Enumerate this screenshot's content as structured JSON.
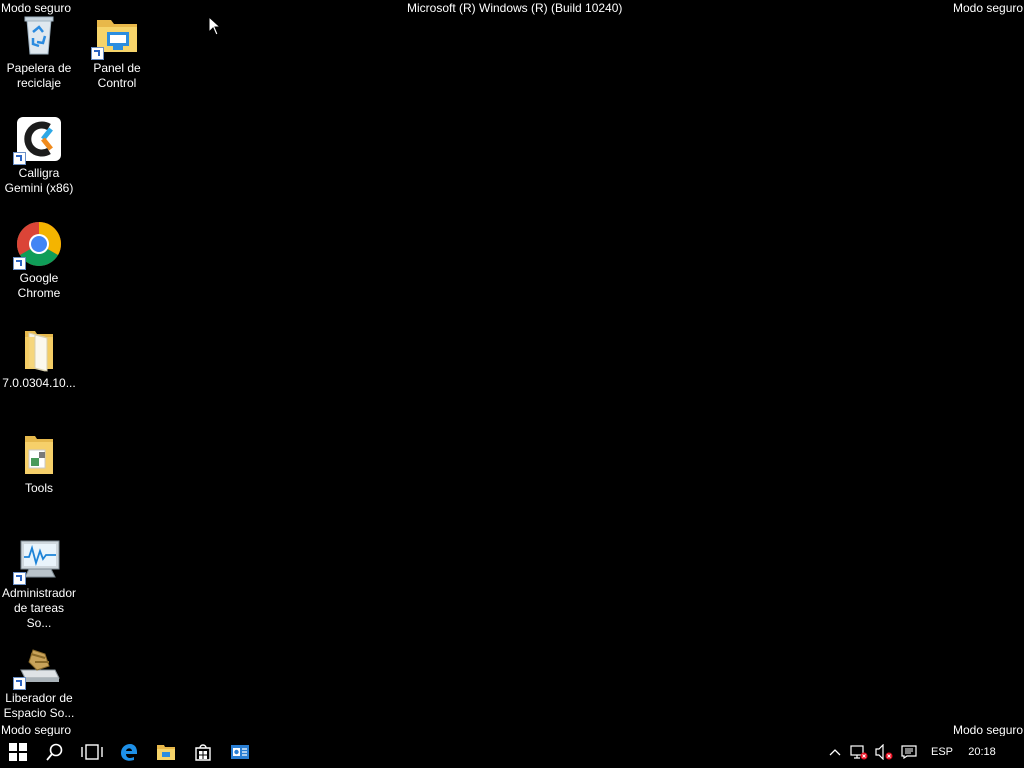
{
  "overlay": {
    "safe_mode": "Modo seguro",
    "build": "Microsoft (R) Windows (R) (Build 10240)"
  },
  "desktop_icons": [
    {
      "label": "Papelera de reciclaje",
      "icon": "recycle-bin-icon"
    },
    {
      "label": "Panel de Control",
      "icon": "control-panel-icon"
    },
    {
      "label": "Calligra Gemini (x86)",
      "icon": "calligra-icon"
    },
    {
      "label": "Google Chrome",
      "icon": "chrome-icon"
    },
    {
      "label": "7.0.0304.10...",
      "icon": "folder-icon"
    },
    {
      "label": "Tools",
      "icon": "folder-icon"
    },
    {
      "label": "Administrador de tareas So...",
      "icon": "task-manager-icon"
    },
    {
      "label": "Liberador de Espacio So...",
      "icon": "disk-cleanup-icon"
    }
  ],
  "taskbar": {
    "language": "ESP",
    "clock": "20:18"
  },
  "colors": {
    "background": "#000000",
    "accent": "#0078d7"
  }
}
